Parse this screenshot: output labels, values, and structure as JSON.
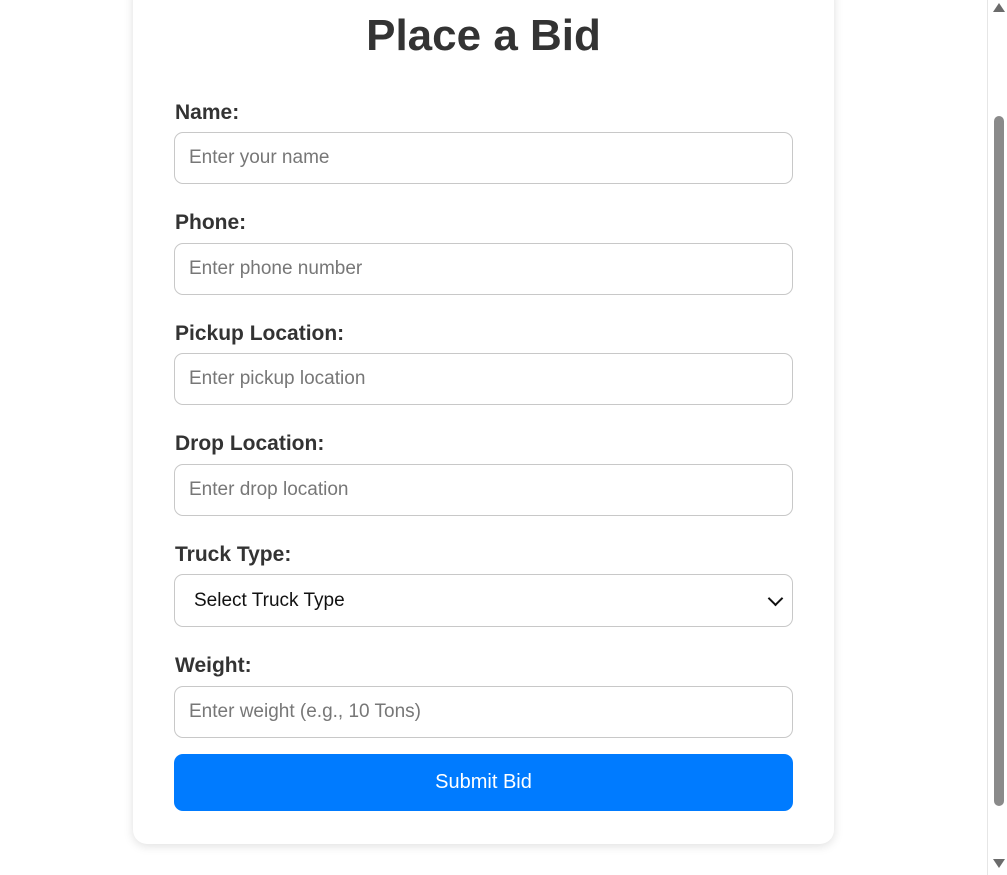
{
  "form": {
    "title": "Place a Bid",
    "fields": [
      {
        "label": "Name:",
        "placeholder": "Enter your name"
      },
      {
        "label": "Phone:",
        "placeholder": "Enter phone number"
      },
      {
        "label": "Pickup Location:",
        "placeholder": "Enter pickup location"
      },
      {
        "label": "Drop Location:",
        "placeholder": "Enter drop location"
      }
    ],
    "truck_type": {
      "label": "Truck Type:",
      "selected": "Select Truck Type"
    },
    "weight": {
      "label": "Weight:",
      "placeholder": "Enter weight (e.g., 10 Tons)"
    },
    "submit_label": "Submit Bid"
  }
}
